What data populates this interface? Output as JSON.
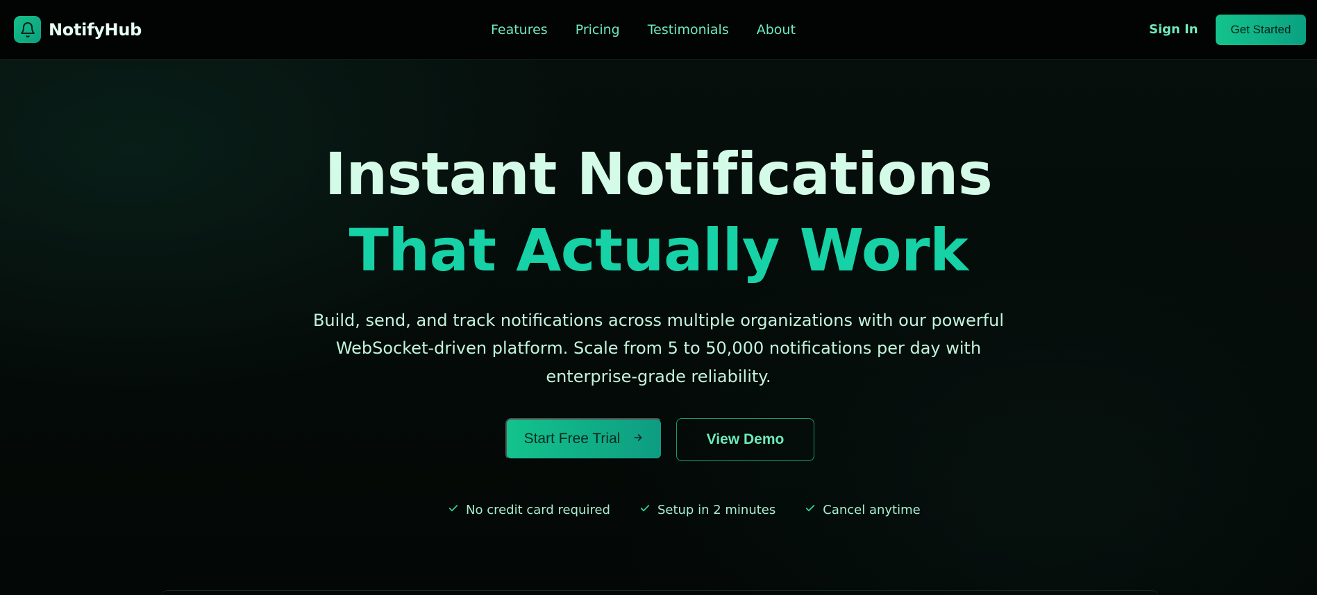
{
  "header": {
    "brand": "NotifyHub",
    "nav": [
      "Features",
      "Pricing",
      "Testimonials",
      "About"
    ],
    "sign_in": "Sign In",
    "get_started": "Get Started"
  },
  "hero": {
    "title_line1": "Instant Notifications",
    "title_line2": "That Actually Work",
    "subtitle_lines": [
      "Build, send, and track notifications across multiple organizations with our powerful",
      "WebSocket-driven platform. Scale from 5 to 50,000 notifications per day with",
      "enterprise-grade reliability."
    ],
    "primary_cta": "Start Free Trial",
    "secondary_cta": "View Demo",
    "perks": [
      "No credit card required",
      "Setup in 2 minutes",
      "Cancel anytime"
    ]
  },
  "colors": {
    "accent": "#14c38c",
    "heading_light": "#d4fbe8",
    "heading_accent": "#16d2a6",
    "nav_text": "#6ee9bc",
    "background": "#040807"
  },
  "icons": {
    "logo": "bell-icon",
    "cta_arrow": "arrow-right-icon",
    "perk": "check-icon"
  }
}
